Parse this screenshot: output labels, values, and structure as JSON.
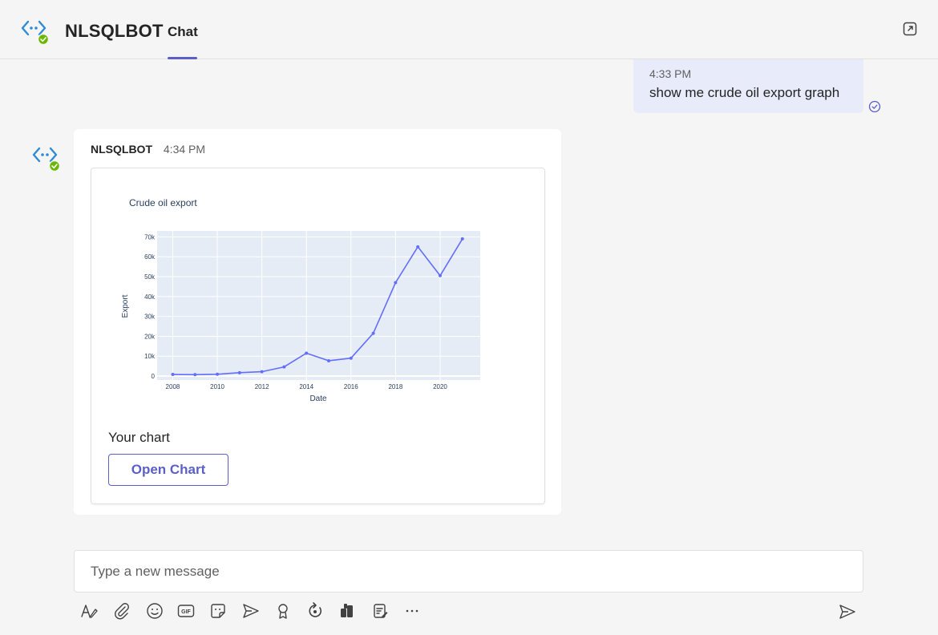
{
  "header": {
    "app_name": "NLSQLBOT",
    "tab_label": "Chat",
    "accent_color": "#5b5fc7"
  },
  "outgoing_message": {
    "time": "4:33 PM",
    "text": "show me crude oil export graph"
  },
  "incoming_message": {
    "sender": "NLSQLBOT",
    "time": "4:34 PM",
    "card": {
      "caption": "Your chart",
      "button_label": "Open Chart"
    }
  },
  "chart_data": {
    "type": "line",
    "title": "Crude oil export",
    "xlabel": "Date",
    "ylabel": "Export",
    "xlim": [
      2007.3,
      2021.8
    ],
    "ylim": [
      -2000,
      73000
    ],
    "x_ticks": [
      "2008",
      "2010",
      "2012",
      "2014",
      "2016",
      "2018",
      "2020"
    ],
    "y_ticks": [
      "0",
      "10k",
      "20k",
      "30k",
      "40k",
      "50k",
      "60k",
      "70k"
    ],
    "x": [
      2008,
      2009,
      2010,
      2011,
      2012,
      2013,
      2014,
      2015,
      2016,
      2017,
      2018,
      2019,
      2020,
      2021
    ],
    "y": [
      800,
      700,
      900,
      1700,
      2200,
      4600,
      11500,
      7700,
      9000,
      21500,
      47000,
      65000,
      50500,
      69000
    ],
    "series_color": "#636efa",
    "plot_background": "#e5ecf6",
    "grid": true
  },
  "compose": {
    "placeholder": "Type a new message"
  },
  "toolbar": {
    "icons": [
      "format-icon",
      "attach-icon",
      "emoji-icon",
      "gif-icon",
      "sticker-icon",
      "schedule-send-icon",
      "praise-icon",
      "loop-icon",
      "apps-icon",
      "forms-icon",
      "more-icon",
      "send-icon"
    ],
    "gif_label": "GIF"
  }
}
